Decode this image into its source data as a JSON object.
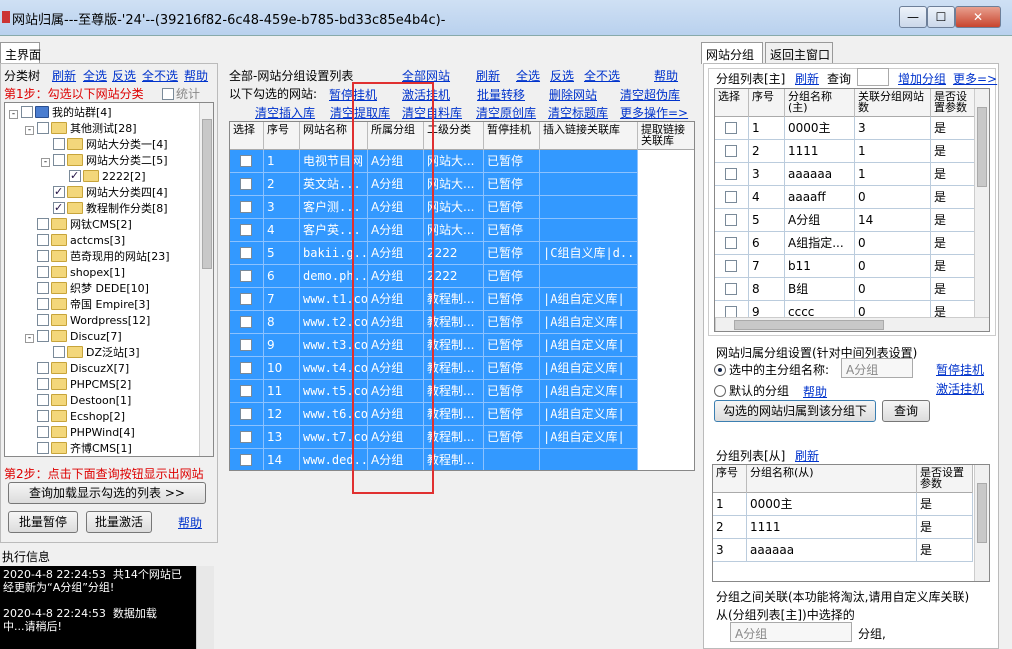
{
  "window": {
    "title": "网站归属---至尊版-'24'--(39216f82-6c48-459e-b785-bd33c85e4b4c)-",
    "min": "—",
    "max": "☐",
    "close": "✕"
  },
  "left": {
    "tab": "主界面",
    "toolbar": {
      "label": "分类树",
      "refresh": "刷新",
      "all": "全选",
      "invert": "反选",
      "none": "全不选",
      "help": "帮助"
    },
    "step1": "第1步：勾选以下网站分类",
    "stats": "统计",
    "tree": [
      {
        "label": "我的站群[4]",
        "lvl": 0,
        "exp": "-",
        "chk": false,
        "root": true
      },
      {
        "label": "其他测试[28]",
        "lvl": 1,
        "exp": "-",
        "chk": false
      },
      {
        "label": "网站大分类一[4]",
        "lvl": 2,
        "exp": "",
        "chk": false
      },
      {
        "label": "网站大分类二[5]",
        "lvl": 2,
        "exp": "-",
        "chk": false
      },
      {
        "label": "2222[2]",
        "lvl": 3,
        "exp": "",
        "chk": true
      },
      {
        "label": "网站大分类四[4]",
        "lvl": 2,
        "exp": "",
        "chk": true
      },
      {
        "label": "教程制作分类[8]",
        "lvl": 2,
        "exp": "",
        "chk": true
      },
      {
        "label": "网钛CMS[2]",
        "lvl": 1,
        "exp": "",
        "chk": false
      },
      {
        "label": "actcms[3]",
        "lvl": 1,
        "exp": "",
        "chk": false
      },
      {
        "label": "芭奇现用的网站[23]",
        "lvl": 1,
        "exp": "",
        "chk": false
      },
      {
        "label": "shopex[1]",
        "lvl": 1,
        "exp": "",
        "chk": false
      },
      {
        "label": "织梦 DEDE[10]",
        "lvl": 1,
        "exp": "",
        "chk": false
      },
      {
        "label": "帝国 Empire[3]",
        "lvl": 1,
        "exp": "",
        "chk": false
      },
      {
        "label": "Wordpress[12]",
        "lvl": 1,
        "exp": "",
        "chk": false
      },
      {
        "label": "Discuz[7]",
        "lvl": 1,
        "exp": "-",
        "chk": false
      },
      {
        "label": "DZ泛站[3]",
        "lvl": 2,
        "exp": "",
        "chk": false
      },
      {
        "label": "DiscuzX[7]",
        "lvl": 1,
        "exp": "",
        "chk": false
      },
      {
        "label": "PHPCMS[2]",
        "lvl": 1,
        "exp": "",
        "chk": false
      },
      {
        "label": "Destoon[1]",
        "lvl": 1,
        "exp": "",
        "chk": false
      },
      {
        "label": "Ecshop[2]",
        "lvl": 1,
        "exp": "",
        "chk": false
      },
      {
        "label": "PHPWind[4]",
        "lvl": 1,
        "exp": "",
        "chk": false
      },
      {
        "label": "齐博CMS[1]",
        "lvl": 1,
        "exp": "",
        "chk": false
      }
    ],
    "step2": "第2步：点击下面查询按钮显示出网站",
    "query_btn": "查询加载显示勾选的列表 >>",
    "batch_pause": "批量暂停",
    "batch_activate": "批量激活",
    "help2": "帮助",
    "log_title": "执行信息",
    "log": "2020-4-8 22:24:53  共14个网站已\n经更新为“A分组”分组!\n\n2020-4-8 22:24:53  数据加载\n中...请稍后!"
  },
  "middle": {
    "title": "全部-网站分组设置列表",
    "all_sites": "全部网站",
    "refresh": "刷新",
    "all": "全选",
    "invert": "反选",
    "none": "全不选",
    "help": "帮助",
    "checked_label": "以下勾选的网站:",
    "actions1": [
      "暂停挂机",
      "激活挂机",
      "批量转移",
      "删除网站",
      "清空超伪库"
    ],
    "actions2": [
      "清空插入库",
      "清空提取库",
      "清空自料库",
      "清空原创库",
      "清空标题库",
      "更多操作=>"
    ],
    "columns": [
      "选择",
      "序号",
      "网站名称",
      "所属分组",
      "二级分类",
      "暂停挂机",
      "插入链接关联库",
      "提取链接关联库"
    ],
    "rows": [
      [
        "1",
        "电视节目网",
        "A分组",
        "网站大...",
        "已暂停",
        ""
      ],
      [
        "2",
        "英文站...",
        "A分组",
        "网站大...",
        "已暂停",
        ""
      ],
      [
        "3",
        "客户测...",
        "A分组",
        "网站大...",
        "已暂停",
        ""
      ],
      [
        "4",
        "客户英...",
        "A分组",
        "网站大...",
        "已暂停",
        ""
      ],
      [
        "5",
        "bakii.g...",
        "A分组",
        "2222",
        "已暂停",
        "|C组自义库|d..."
      ],
      [
        "6",
        "demo.ph...",
        "A分组",
        "2222",
        "已暂停",
        ""
      ],
      [
        "7",
        "www.t1.com",
        "A分组",
        "教程制...",
        "已暂停",
        "|A组自定义库|"
      ],
      [
        "8",
        "www.t2.com",
        "A分组",
        "教程制...",
        "已暂停",
        "|A组自定义库|"
      ],
      [
        "9",
        "www.t3.com",
        "A分组",
        "教程制...",
        "已暂停",
        "|A组自定义库|"
      ],
      [
        "10",
        "www.t4.com",
        "A分组",
        "教程制...",
        "已暂停",
        "|A组自定义库|"
      ],
      [
        "11",
        "www.t5.com",
        "A分组",
        "教程制...",
        "已暂停",
        "|A组自定义库|"
      ],
      [
        "12",
        "www.t6.com",
        "A分组",
        "教程制...",
        "已暂停",
        "|A组自定义库|"
      ],
      [
        "13",
        "www.t7.com",
        "A分组",
        "教程制...",
        "已暂停",
        "|A组自定义库|"
      ],
      [
        "14",
        "www.ded...",
        "A分组",
        "教程制...",
        "",
        ""
      ]
    ]
  },
  "right": {
    "tabs": [
      "网站分组",
      "返回主窗口"
    ],
    "main_list": {
      "label": "分组列表[主]",
      "refresh": "刷新",
      "query": "查询",
      "add": "增加分组",
      "more": "更多=>",
      "columns": [
        "选择",
        "序号",
        "分组名称(主)",
        "关联分组网站数",
        "是否设置参数"
      ],
      "rows": [
        [
          "1",
          "0000主",
          "3",
          "是"
        ],
        [
          "2",
          "1111",
          "1",
          "是"
        ],
        [
          "3",
          "aaaaaa",
          "1",
          "是"
        ],
        [
          "4",
          "aaaaff",
          "0",
          "是"
        ],
        [
          "5",
          "A分组",
          "14",
          "是"
        ],
        [
          "6",
          "A组指定...",
          "0",
          "是"
        ],
        [
          "7",
          "b11",
          "0",
          "是"
        ],
        [
          "8",
          "B组",
          "0",
          "是"
        ],
        [
          "9",
          "cccc",
          "0",
          "是"
        ]
      ]
    },
    "settings": {
      "title": "网站归属分组设置(针对中间列表设置)",
      "opt1": "选中的主分组名称:",
      "opt1_value": "A分组",
      "opt2": "默认的分组",
      "help": "帮助",
      "pause": "暂停挂机",
      "activate": "激活挂机",
      "assign_btn": "勾选的网站归属到该分组下",
      "query_btn": "查询"
    },
    "sub_list": {
      "label": "分组列表[从]",
      "refresh": "刷新",
      "columns": [
        "序号",
        "分组名称(从)",
        "是否设置参数"
      ],
      "rows": [
        [
          "1",
          "0000主",
          "是"
        ],
        [
          "2",
          "1111",
          "是"
        ],
        [
          "3",
          "aaaaaa",
          "是"
        ]
      ]
    },
    "relation": {
      "title": "分组之间关联(本功能将淘汰,请用自定义库关联)",
      "line1": "从(分组列表[主])中选择的",
      "value": "A分组",
      "suffix": "分组,"
    }
  }
}
